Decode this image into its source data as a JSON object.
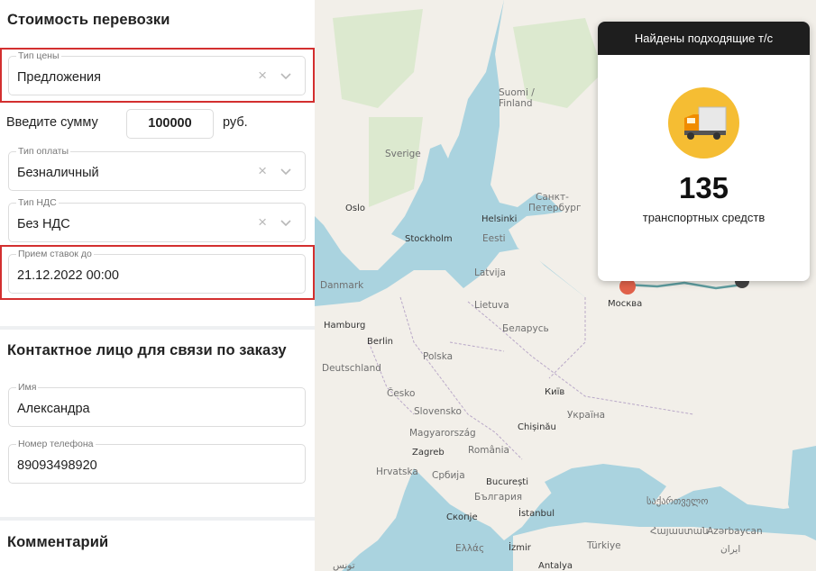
{
  "cost_section": {
    "title": "Стоимость перевозки",
    "price_type": {
      "label": "Тип цены",
      "value": "Предложения"
    },
    "amount": {
      "label": "Введите сумму",
      "value": "100000",
      "unit": "руб."
    },
    "payment_type": {
      "label": "Тип оплаты",
      "value": "Безналичный"
    },
    "vat_type": {
      "label": "Тип НДС",
      "value": "Без НДС"
    },
    "bids_until": {
      "label": "Прием ставок до",
      "value": "21.12.2022 00:00"
    },
    "clear_symbol": "×"
  },
  "contact_section": {
    "title": "Контактное лицо для связи по заказу",
    "name": {
      "label": "Имя",
      "value": "Александра"
    },
    "phone": {
      "label": "Номер телефона",
      "value": "89093498920"
    }
  },
  "comment_section": {
    "title": "Комментарий"
  },
  "map": {
    "labels": {
      "suomi": "Suomi /",
      "finland": "Finland",
      "sverige": "Sverige",
      "sankt": "Санкт-",
      "peterburg": "Петербург",
      "oslo": "Oslo",
      "helsinki": "Helsinki",
      "stockholm": "Stockholm",
      "eesti": "Eesti",
      "latvija": "Latvija",
      "danmark": "Danmark",
      "lietuva": "Lietuva",
      "moskva": "Москва",
      "hamburg": "Hamburg",
      "belarus": "Беларусь",
      "berlin": "Berlin",
      "polska": "Polska",
      "deutschland": "Deutschland",
      "cesko": "Česko",
      "kyiv": "Київ",
      "slovensko": "Slovensko",
      "ukraina": "Україна",
      "chisinau": "Chișinău",
      "magyarorszag": "Magyarország",
      "zagreb": "Zagreb",
      "romania": "România",
      "hrvatska": "Hrvatska",
      "srbija": "Србија",
      "bucuresti": "București",
      "bulgaria": "България",
      "sakartvelo": "საქართველო",
      "skopje": "Скопје",
      "istanbul": "İstanbul",
      "hayastan": "Հայաստան",
      "azerbaycan": "Azərbaycan",
      "ellas": "Ελλάς",
      "izmir": "İzmir",
      "turkiye": "Türkiye",
      "antalya": "Antalya",
      "iran": "ایران",
      "tunis": "تونس"
    },
    "colors": {
      "sea": "#aad3df",
      "land": "#f2efe9",
      "forest": "#dce9cf",
      "route": "#5f9ea0",
      "marker": "#e0614a"
    }
  },
  "results_card": {
    "title": "Найдены подходящие т/с",
    "count": "135",
    "subtitle": "транспортных средств",
    "icon": "truck-icon",
    "icon_bg": "#f5bd33"
  }
}
